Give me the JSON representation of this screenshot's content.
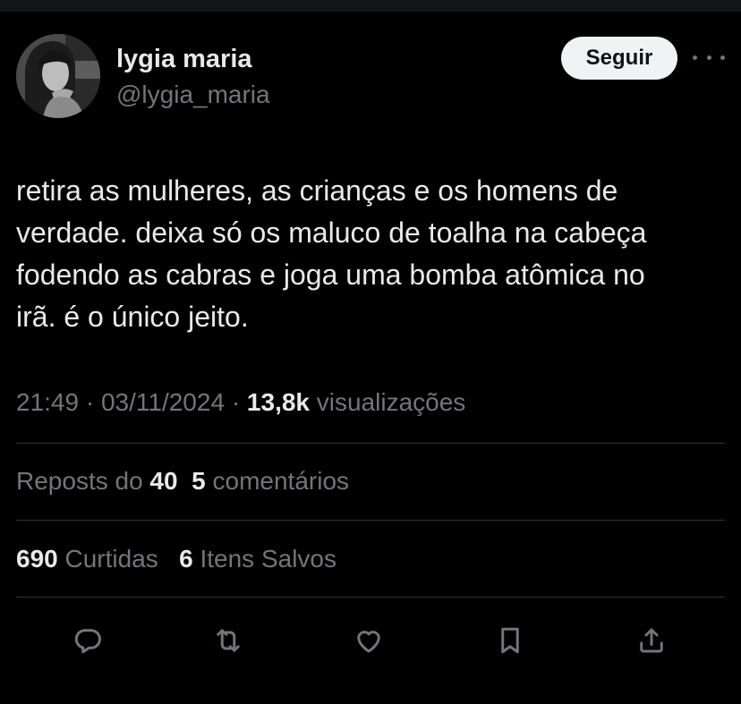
{
  "author": {
    "name": "lygia maria",
    "handle": "@lygia_maria"
  },
  "follow_label": "Seguir",
  "tweet": {
    "text": "retira as mulheres, as crianças e os homens de\nverdade. deixa só os maluco de toalha na cabeça\nfodendo as cabras e joga uma bomba atômica no\nirã. é o único jeito."
  },
  "meta": {
    "time": "21:49",
    "separator": "·",
    "date": "03/11/2024",
    "views_count": "13,8k",
    "views_label": "visualizações"
  },
  "stats": {
    "reposts_label": "Reposts do",
    "reposts_count": "40",
    "comments_count": "5",
    "comments_label": "comentários",
    "likes_count": "690",
    "likes_label": "Curtidas",
    "saves_count": "6",
    "saves_label": "Itens Salvos"
  },
  "actions": [
    {
      "icon": "reply-icon"
    },
    {
      "icon": "repost-icon"
    },
    {
      "icon": "like-icon"
    },
    {
      "icon": "bookmark-icon"
    },
    {
      "icon": "share-icon"
    }
  ],
  "colors": {
    "background": "#000000",
    "primary_text": "#e7e9ea",
    "secondary_text": "#71767b",
    "divider": "#2f3336",
    "button_bg": "#eff3f4"
  }
}
